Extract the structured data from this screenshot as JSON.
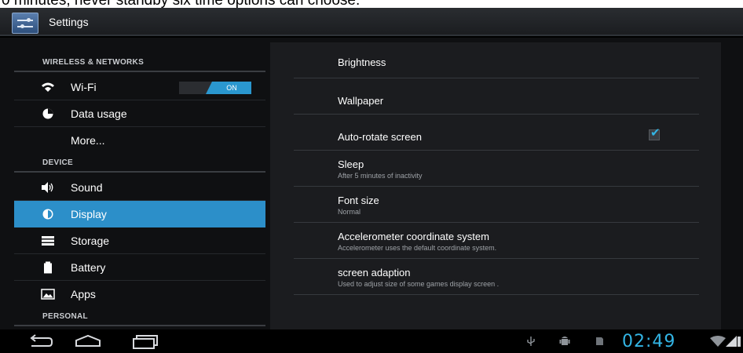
{
  "caption": "0 minutes, never standby six time options can choose.",
  "actionbar": {
    "title": "Settings",
    "icon": "settings-sliders-icon"
  },
  "left_pane": {
    "sections": {
      "wireless": "WIRELESS & NETWORKS",
      "device": "DEVICE",
      "personal": "PERSONAL"
    },
    "items": [
      {
        "label": "Wi-Fi",
        "icon": "wifi-icon",
        "toggle": "ON"
      },
      {
        "label": "Data usage",
        "icon": "data-usage-icon"
      },
      {
        "label": "More...",
        "icon": ""
      },
      {
        "label": "Sound",
        "icon": "speaker-icon"
      },
      {
        "label": "Display",
        "icon": "brightness-icon",
        "selected": true
      },
      {
        "label": "Storage",
        "icon": "storage-icon"
      },
      {
        "label": "Battery",
        "icon": "battery-icon"
      },
      {
        "label": "Apps",
        "icon": "apps-icon"
      }
    ]
  },
  "right_pane": {
    "items": [
      {
        "title": "Brightness",
        "summary": ""
      },
      {
        "title": "Wallpaper",
        "summary": ""
      },
      {
        "title": "Auto-rotate screen",
        "summary": "",
        "checked": true
      },
      {
        "title": "Sleep",
        "summary": "After 5 minutes of inactivity"
      },
      {
        "title": "Font size",
        "summary": "Normal"
      },
      {
        "title": "Accelerometer coordinate system",
        "summary": "Accelerometer uses the default coordinate system."
      },
      {
        "title": "screen adaption",
        "summary": "Used to adjust size of some games display screen ."
      }
    ]
  },
  "navbar": {
    "buttons": [
      "back-icon",
      "home-icon",
      "recent-apps-icon"
    ],
    "tray_icons": [
      "usb-icon",
      "android-debug-icon",
      "sd-card-icon",
      "wifi-signal-icon",
      "battery-status-icon"
    ],
    "clock": "02:49"
  },
  "colors": {
    "accent": "#33b5e5",
    "selected_bg": "#2c8fc9",
    "toggle_on": "#2a97cf"
  }
}
